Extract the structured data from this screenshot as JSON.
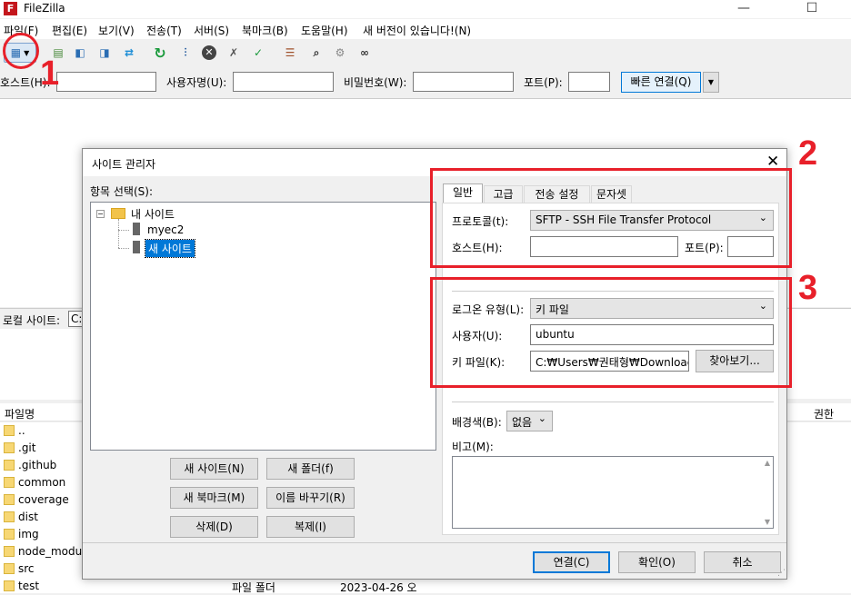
{
  "app": {
    "title": "FileZilla",
    "icon_letter": "F"
  },
  "menu": [
    "파일(F)",
    "편집(E)",
    "보기(V)",
    "전송(T)",
    "서버(S)",
    "북마크(B)",
    "도움말(H)",
    "새 버전이 있습니다!(N)"
  ],
  "toolbar": {
    "icons": [
      "site-manager-icon",
      "log-icon",
      "local-tree-icon",
      "remote-tree-icon",
      "transfer-queue-icon",
      "refresh-icon",
      "filter-icon",
      "cancel-icon",
      "disconnect-icon",
      "reconnect-icon",
      "compare-icon",
      "search-icon",
      "sync-icon",
      "binoculars-icon"
    ]
  },
  "quickconnect": {
    "host_label": "호스트(H):",
    "user_label": "사용자명(U):",
    "password_label": "비밀번호(W):",
    "port_label": "포트(P):",
    "connect_button": "빠른 연결(Q)"
  },
  "local": {
    "label": "로컬 사이트:",
    "path": "C:"
  },
  "files": {
    "header_name": "파일명",
    "header_perm": "권한",
    "rows": [
      {
        "name": ".."
      },
      {
        "name": ".git"
      },
      {
        "name": ".github"
      },
      {
        "name": "common"
      },
      {
        "name": "coverage"
      },
      {
        "name": "dist"
      },
      {
        "name": "img"
      },
      {
        "name": "node_module"
      },
      {
        "name": "src"
      },
      {
        "name": "test",
        "type": "파일 폴더",
        "date": "2023-04-26 오"
      }
    ]
  },
  "dialog": {
    "title": "사이트 관리자",
    "tree_label": "항목 선택(S):",
    "tree": {
      "root": "내 사이트",
      "items": [
        "myec2",
        "새 사이트"
      ],
      "selected": "새 사이트"
    },
    "buttons": {
      "new_site": "새 사이트(N)",
      "new_folder": "새 폴더(f)",
      "new_bookmark": "새 북마크(M)",
      "rename": "이름 바꾸기(R)",
      "delete": "삭제(D)",
      "duplicate": "복제(I)"
    },
    "tabs": [
      "일반",
      "고급",
      "전송 설정",
      "문자셋"
    ],
    "active_tab": "일반",
    "general": {
      "protocol_label": "프로토콜(t):",
      "protocol_value": "SFTP - SSH File Transfer Protocol",
      "host_label": "호스트(H):",
      "host_value": "",
      "port_label": "포트(P):",
      "port_value": "",
      "logon_label": "로그온 유형(L):",
      "logon_value": "키 파일",
      "user_label": "사용자(U):",
      "user_value": "ubuntu",
      "keyfile_label": "키 파일(K):",
      "keyfile_value": "C:₩Users₩권태형₩Downloads₩",
      "browse_button": "찾아보기...",
      "bgcolor_label": "배경색(B):",
      "bgcolor_value": "없음",
      "comment_label": "비고(M):"
    },
    "footer": {
      "connect": "연결(C)",
      "ok": "확인(O)",
      "cancel": "취소"
    }
  },
  "annotations": [
    "1",
    "2",
    "3"
  ],
  "colors": {
    "annotation_red": "#e8202a",
    "selection_blue": "#0078d7",
    "accent_border": "#0078d7"
  }
}
